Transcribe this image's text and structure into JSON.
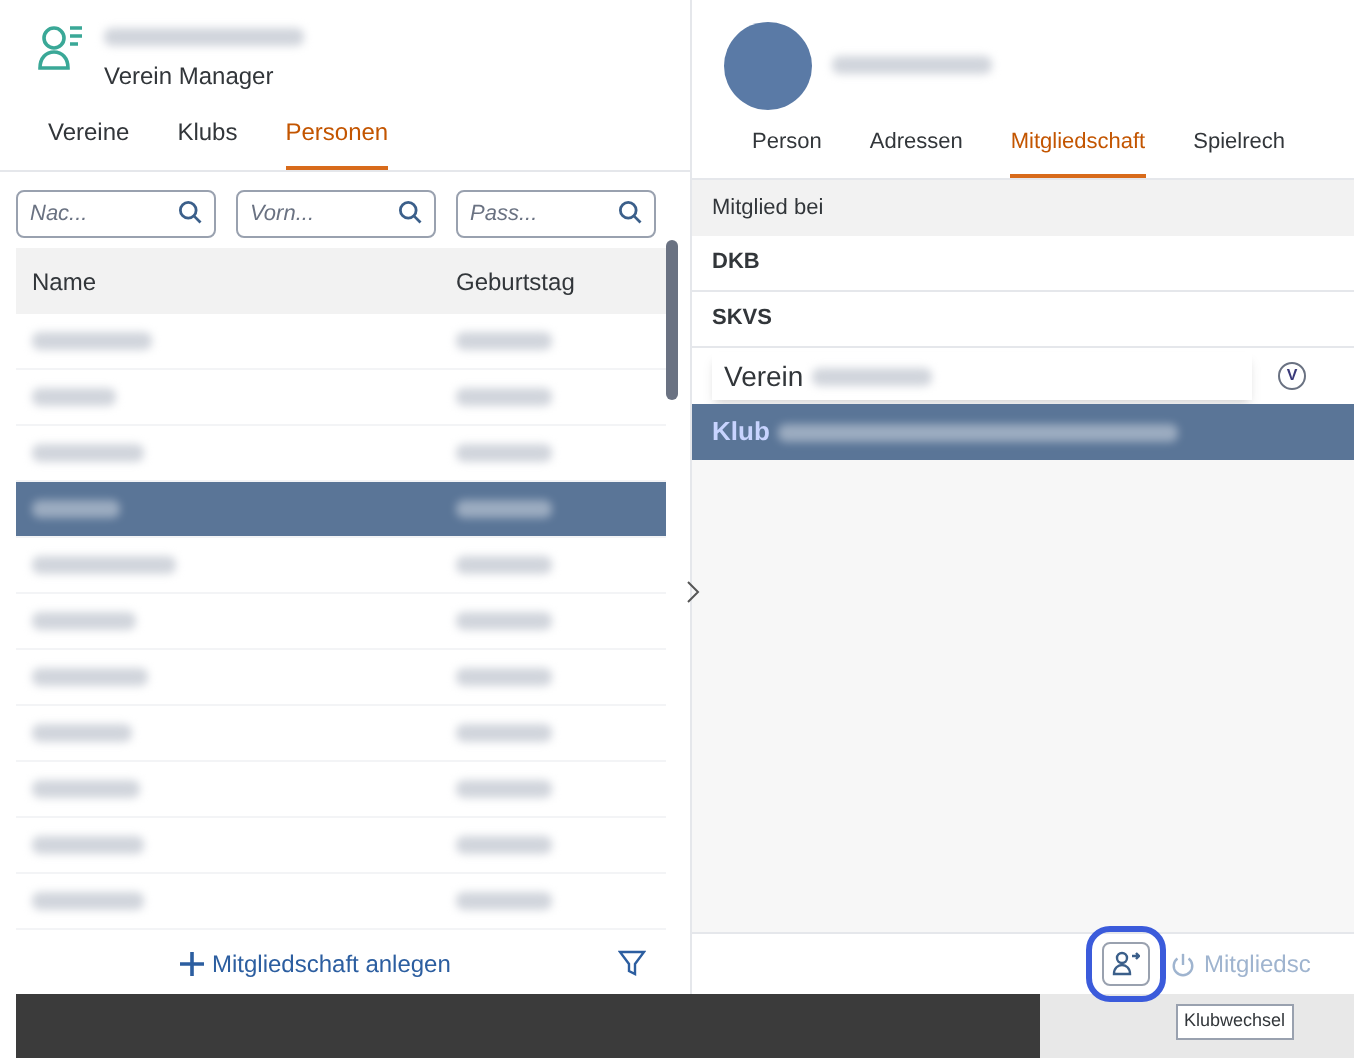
{
  "app": {
    "subtitle": "Verein Manager"
  },
  "tabs": [
    {
      "label": "Vereine",
      "selected": false
    },
    {
      "label": "Klubs",
      "selected": false
    },
    {
      "label": "Personen",
      "selected": true
    }
  ],
  "filters": [
    {
      "placeholder": "Nac..."
    },
    {
      "placeholder": "Vorn..."
    },
    {
      "placeholder": "Pass..."
    }
  ],
  "persons": {
    "columns": [
      "Name",
      "Geburtstag"
    ],
    "rows": [
      {
        "selected": false
      },
      {
        "selected": false
      },
      {
        "selected": false
      },
      {
        "selected": true
      },
      {
        "selected": false
      },
      {
        "selected": false
      },
      {
        "selected": false
      },
      {
        "selected": false
      },
      {
        "selected": false
      },
      {
        "selected": false
      },
      {
        "selected": false
      }
    ]
  },
  "footer": {
    "add_button": "Mitgliedschaft anlegen"
  },
  "detail": {
    "tabs": [
      {
        "label": "Person",
        "selected": false
      },
      {
        "label": "Adressen",
        "selected": false
      },
      {
        "label": "Mitgliedschaft",
        "selected": true
      },
      {
        "label": "Spielrech",
        "selected": false
      }
    ],
    "column": "Mitglied bei",
    "rows": [
      {
        "kind": "plain",
        "label": "DKB",
        "selected": false
      },
      {
        "kind": "plain",
        "label": "SKVS",
        "selected": false
      },
      {
        "kind": "overlay",
        "label": "Verein",
        "badge": "V",
        "selected": false
      },
      {
        "kind": "highlight",
        "label": "Klub",
        "selected": true
      }
    ]
  },
  "actions": {
    "switch_button_tooltip": "Klubwechsel",
    "end_button": "Mitgliedsc"
  }
}
